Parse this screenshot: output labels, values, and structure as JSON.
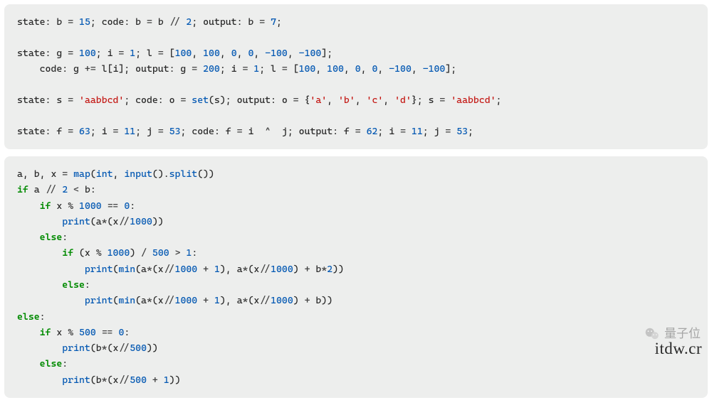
{
  "block1": {
    "l1": [
      "state: b ",
      "=",
      " ",
      "15",
      "; code: b ",
      "=",
      " b ",
      "//",
      " ",
      "2",
      "; output: b ",
      "=",
      " ",
      "7",
      ";"
    ],
    "l2": [
      ""
    ],
    "l3": [
      "state: g ",
      "=",
      " ",
      "100",
      "; i ",
      "=",
      " ",
      "1",
      "; l ",
      "=",
      " [",
      "100",
      ", ",
      "100",
      ", ",
      "0",
      ", ",
      "0",
      ", ",
      "-100",
      ", ",
      "-100",
      "];"
    ],
    "l4": [
      "    code: g ",
      "+=",
      " l[i]; output: g ",
      "=",
      " ",
      "200",
      "; i ",
      "=",
      " ",
      "1",
      "; l ",
      "=",
      " [",
      "100",
      ", ",
      "100",
      ", ",
      "0",
      ", ",
      "0",
      ", ",
      "-100",
      ", ",
      "-100",
      "];"
    ],
    "l5": [
      ""
    ],
    "l6": [
      "state: s ",
      "=",
      " ",
      "'aabbcd'",
      "; code: o ",
      "=",
      " ",
      "set",
      "(s); output: o ",
      "=",
      " {",
      "'a'",
      ", ",
      "'b'",
      ", ",
      "'c'",
      ", ",
      "'d'",
      "}; s ",
      "=",
      " ",
      "'aabbcd'",
      ";"
    ],
    "l7": [
      ""
    ],
    "l8": [
      "state: f ",
      "=",
      " ",
      "63",
      "; i ",
      "=",
      " ",
      "11",
      "; j ",
      "=",
      " ",
      "53",
      "; code: f ",
      "=",
      " i ",
      " ^ ",
      " j; output: f ",
      "=",
      " ",
      "62",
      "; i ",
      "=",
      " ",
      "11",
      "; j ",
      "=",
      " ",
      "53",
      ";"
    ]
  },
  "block2": {
    "l1": [
      "a, b, x ",
      "=",
      " ",
      "map",
      "(",
      "int",
      ", ",
      "input",
      "().",
      "split",
      "())"
    ],
    "l2": [
      "if",
      " a ",
      "//",
      " ",
      "2",
      " ",
      "<",
      " b:"
    ],
    "l3": [
      "    ",
      "if",
      " x ",
      "%",
      " ",
      "1000",
      " ",
      "==",
      " ",
      "0",
      ":"
    ],
    "l4": [
      "        ",
      "print",
      "(a",
      "*",
      "(x",
      "//",
      "1000",
      "))"
    ],
    "l5": [
      "    ",
      "else",
      ":"
    ],
    "l6": [
      "        ",
      "if",
      " (x ",
      "%",
      " ",
      "1000",
      ") ",
      "/",
      " ",
      "500",
      " ",
      ">",
      " ",
      "1",
      ":"
    ],
    "l7": [
      "            ",
      "print",
      "(",
      "min",
      "(a",
      "*",
      "(x",
      "//",
      "1000",
      " ",
      "+",
      " ",
      "1",
      "), a",
      "*",
      "(x",
      "//",
      "1000",
      ") ",
      "+",
      " b",
      "*",
      "2",
      "))"
    ],
    "l8": [
      "        ",
      "else",
      ":"
    ],
    "l9": [
      "            ",
      "print",
      "(",
      "min",
      "(a",
      "*",
      "(x",
      "//",
      "1000",
      " ",
      "+",
      " ",
      "1",
      "), a",
      "*",
      "(x",
      "//",
      "1000",
      ") ",
      "+",
      " b))"
    ],
    "l10": [
      "else",
      ":"
    ],
    "l11": [
      "    ",
      "if",
      " x ",
      "%",
      " ",
      "500",
      " ",
      "==",
      " ",
      "0",
      ":"
    ],
    "l12": [
      "        ",
      "print",
      "(b",
      "*",
      "(x",
      "//",
      "500",
      "))"
    ],
    "l13": [
      "    ",
      "else",
      ":"
    ],
    "l14": [
      "        ",
      "print",
      "(b",
      "*",
      "(x",
      "//",
      "500",
      " ",
      "+",
      " ",
      "1",
      "))"
    ]
  },
  "watermark_text": "量子位",
  "sitelink_text": "itdw.cr"
}
